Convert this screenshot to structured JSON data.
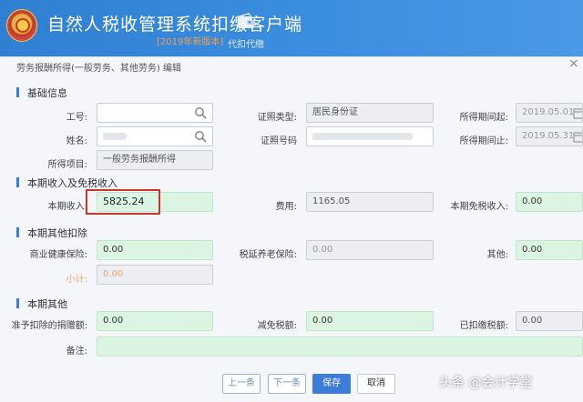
{
  "app": {
    "title": "自然人税收管理系统扣缴客户端",
    "edition": "[2019年新版本]",
    "nav_item": "代扣代缴"
  },
  "dialog": {
    "title": "劳务报酬所得(一般劳务、其他劳务) 编辑",
    "close": "×"
  },
  "basic": {
    "heading": "基础信息",
    "employee_id_label": "工号:",
    "id_type_label": "证照类型:",
    "id_type_value": "居民身份证",
    "period_start_label": "所得期间起:",
    "period_start_value": "2019.05.01",
    "name_label": "姓名:",
    "id_number_label": "证照号码",
    "period_end_label": "所得期间止:",
    "period_end_value": "2019.05.31",
    "item_label": "所得项目:",
    "item_value": "一般劳务报酬所得"
  },
  "income": {
    "heading": "本期收入及免税收入",
    "income_label": "本期收入:",
    "income_value": "5825.24",
    "expense_label": "费用:",
    "expense_value": "1165.05",
    "exempt_label": "本期免税收入:",
    "exempt_value": "0.00"
  },
  "deductions": {
    "heading": "本期其他扣除",
    "health_label": "商业健康保险:",
    "health_value": "0.00",
    "pension_label": "税延养老保险:",
    "pension_value": "0.00",
    "other_label": "其他:",
    "other_value": "0.00",
    "subtotal_label": "小计:",
    "subtotal_value": "0.00"
  },
  "other": {
    "heading": "本期其他",
    "donation_label": "准予扣除的捐赠额:",
    "donation_value": "0.00",
    "relief_label": "减免税额:",
    "relief_value": "0.00",
    "withheld_label": "已扣缴税额:",
    "withheld_value": "0.00",
    "remark_label": "备注:",
    "remark_value": ""
  },
  "buttons": {
    "prev": "上一条",
    "next": "下一条",
    "save": "保存",
    "cancel": "取消"
  },
  "watermark": "头条 @会计学堂",
  "colors": {
    "header_blue": "#2f7fd3",
    "accent_blue": "#3b7dd8",
    "green_field": "#dcf5e3",
    "highlight_red": "#c9382b",
    "subtotal_orange": "#f2a66a"
  }
}
